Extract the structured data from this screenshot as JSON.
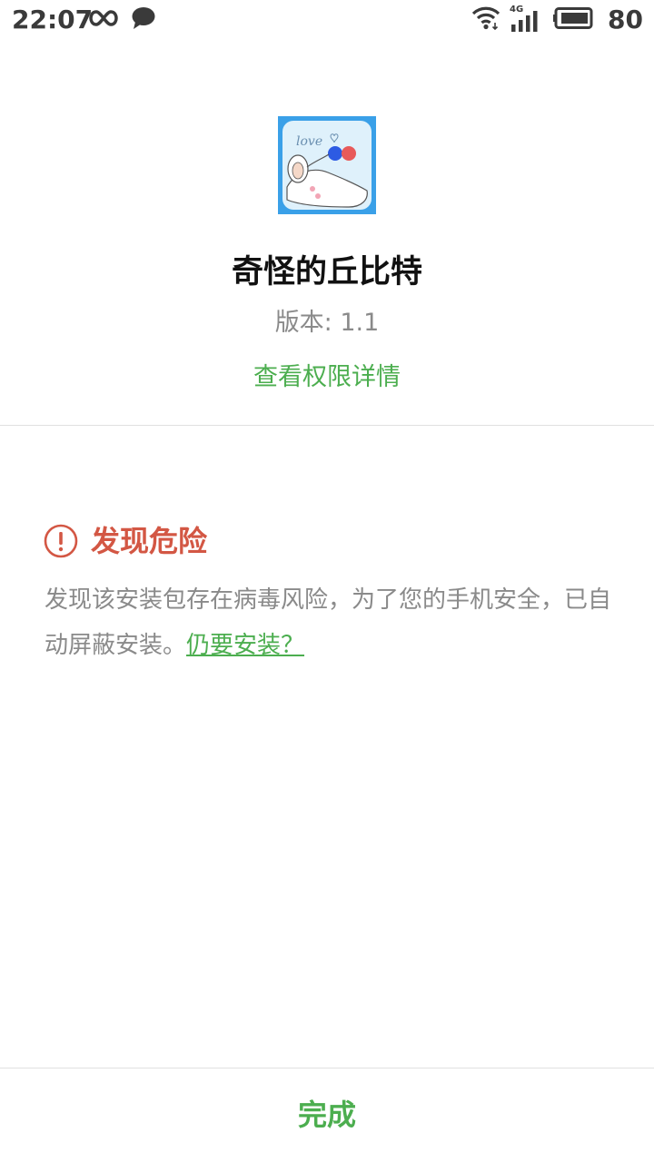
{
  "status_bar": {
    "time": "22:07",
    "network_type": "4G",
    "battery_level": "80",
    "icons": [
      "infinity-icon",
      "chat-bubble-icon",
      "wifi-icon",
      "cell-signal-icon",
      "battery-icon"
    ]
  },
  "app": {
    "icon": "app-icon-love-illustration",
    "name": "奇怪的丘比特",
    "version": "版本: 1.1",
    "permission_link": "查看权限详情"
  },
  "warning": {
    "icon": "exclamation-circle-icon",
    "title": "发现危险",
    "message": "发现该安装包存在病毒风险，为了您的手机安全，已自动屏蔽安装。",
    "install_anyway_link": "仍要安装？"
  },
  "actions": {
    "done_label": "完成"
  },
  "colors": {
    "accent_green": "#4cae4f",
    "danger_red": "#d35744",
    "text_gray": "#8a8a8a",
    "status_text": "#3a3a3a"
  }
}
